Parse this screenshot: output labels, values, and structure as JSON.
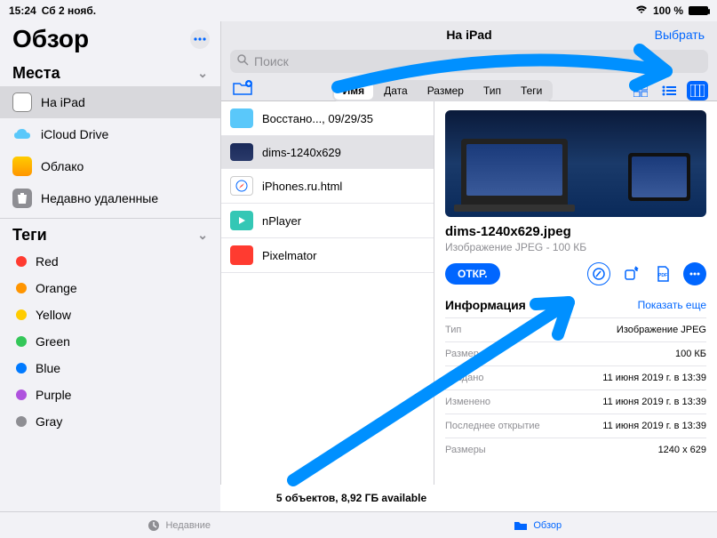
{
  "statusbar": {
    "time": "15:24",
    "date": "Сб 2 нояб.",
    "battery": "100 %"
  },
  "sidebar": {
    "title": "Обзор",
    "places_header": "Места",
    "tags_header": "Теги",
    "places": [
      {
        "label": "На iPad",
        "selected": true
      },
      {
        "label": "iCloud Drive"
      },
      {
        "label": "Облако"
      },
      {
        "label": "Недавно удаленные"
      }
    ],
    "tags": [
      {
        "label": "Red",
        "color": "#ff3b30"
      },
      {
        "label": "Orange",
        "color": "#ff9500"
      },
      {
        "label": "Yellow",
        "color": "#ffcc00"
      },
      {
        "label": "Green",
        "color": "#34c759"
      },
      {
        "label": "Blue",
        "color": "#007aff"
      },
      {
        "label": "Purple",
        "color": "#af52de"
      },
      {
        "label": "Gray",
        "color": "#8e8e93"
      }
    ]
  },
  "topbar": {
    "location": "На iPad",
    "select": "Выбрать",
    "search_placeholder": "Поиск",
    "sort": [
      "Имя",
      "Дата",
      "Размер",
      "Тип",
      "Теги"
    ],
    "sort_active": 0
  },
  "files": [
    {
      "label": "Восстано..., 09/29/35",
      "kind": "folder-blue"
    },
    {
      "label": "dims-1240x629",
      "kind": "thumb",
      "selected": true
    },
    {
      "label": "iPhones.ru.html",
      "kind": "safari"
    },
    {
      "label": "nPlayer",
      "kind": "folder-teal"
    },
    {
      "label": "Pixelmator",
      "kind": "folder-red"
    }
  ],
  "footer": "5 объектов, 8,92 ГБ available",
  "detail": {
    "filename": "dims-1240x629.jpeg",
    "meta": "Изображение JPEG - 100 КБ",
    "open": "ОТКР.",
    "info_header": "Информация",
    "show_more": "Показать еще",
    "rows": [
      {
        "k": "Тип",
        "v": "Изображение JPEG"
      },
      {
        "k": "Размер",
        "v": "100 КБ"
      },
      {
        "k": "Создано",
        "v": "11 июня 2019 г. в 13:39"
      },
      {
        "k": "Изменено",
        "v": "11 июня 2019 г. в 13:39"
      },
      {
        "k": "Последнее открытие",
        "v": "11 июня 2019 г. в 13:39"
      },
      {
        "k": "Размеры",
        "v": "1240 x 629"
      }
    ]
  },
  "tabs": {
    "recent": "Недавние",
    "browse": "Обзор"
  }
}
